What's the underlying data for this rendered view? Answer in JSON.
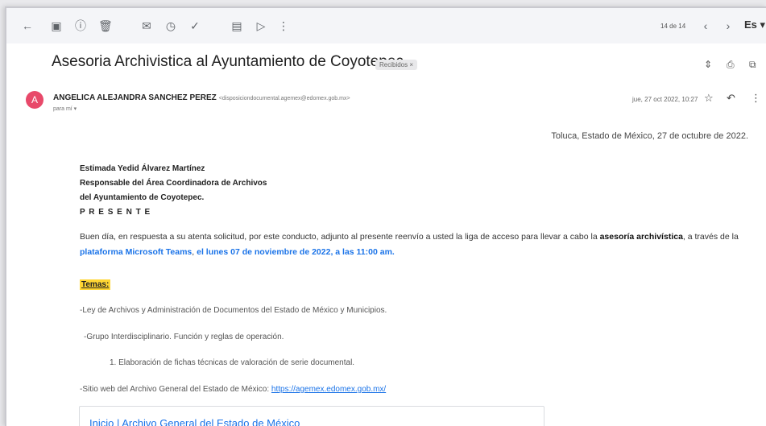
{
  "toolbar": {
    "pager": "14 de 14",
    "lang": "Es ▾"
  },
  "email": {
    "subject": "Asesoria Archivistica al Ayuntamiento de Coyotepec.",
    "label": "Recibidos ×",
    "sender": {
      "avatar_letter": "A",
      "name": "ANGELICA ALEJANDRA SANCHEZ PEREZ",
      "email": "<disposiciondocumental.agemex@edomex.gob.mx>",
      "to": "para mí ▾",
      "date": "jue, 27 oct 2022, 10:27"
    },
    "place_date": "Toluca, Estado de México, 27 de octubre de 2022.",
    "address": [
      "Estimada Yedid Álvarez Martínez",
      "Responsable del Área Coordinadora de Archivos",
      "del Ayuntamiento de Coyotepec.",
      "P R E S E N T E"
    ],
    "intro": {
      "part1": "Buen día, en respuesta a su atenta solicitud, por este conducto, adjunto al presente reenvío a usted la liga de acceso para llevar a cabo la ",
      "bold1": "asesoría archivística",
      "part2": ", a través de la ",
      "blue1": "plataforma Microsoft Teams",
      "part3": ", ",
      "blue2": "el lunes 07 de noviembre de 2022, a las 11:00 am."
    },
    "temas_label": "Temas:",
    "items": [
      "-Ley de Archivos y Administración de Documentos del Estado de México y Municipios.",
      "-Grupo Interdisciplinario. Función y reglas de operación.",
      "1. Elaboración de fichas técnicas de valoración de serie documental."
    ],
    "website": {
      "prefix": "-Sitio web del Archivo General del Estado de México: ",
      "url": "https://agemex.edomex.gob.mx/"
    },
    "preview_title": "Inicio | Archivo General del Estado de México"
  },
  "colors": {
    "avatar": "#e8496a",
    "link": "#1a73e8",
    "highlight": "#ffd633"
  }
}
